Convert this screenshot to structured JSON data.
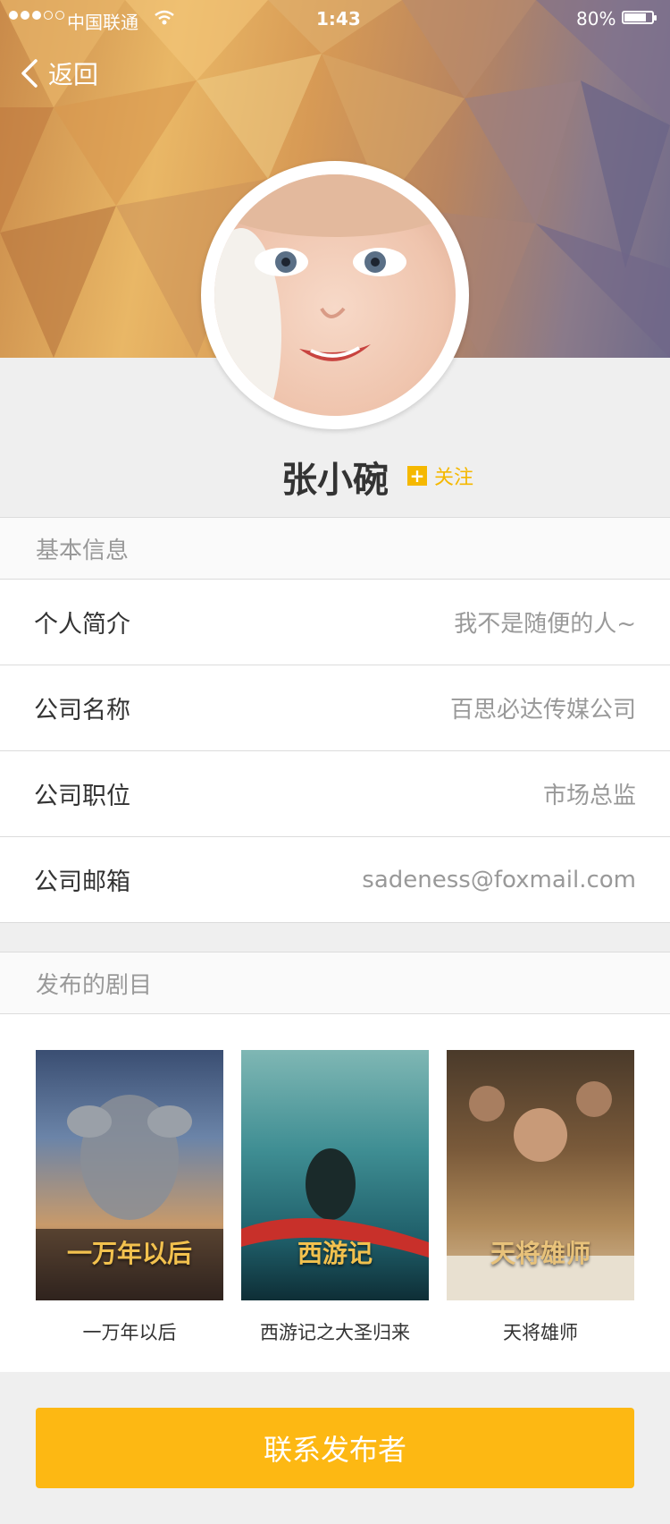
{
  "status_bar": {
    "carrier": "中国联通",
    "time": "1:43",
    "battery": "80%",
    "battery_level": 0.8
  },
  "nav": {
    "back_label": "返回"
  },
  "profile": {
    "name": "张小碗",
    "follow_label": "关注"
  },
  "basic_info": {
    "header": "基本信息",
    "rows": [
      {
        "label": "个人简介",
        "value": "我不是随便的人~"
      },
      {
        "label": "公司名称",
        "value": "百思必达传媒公司"
      },
      {
        "label": "公司职位",
        "value": "市场总监"
      },
      {
        "label": "公司邮箱",
        "value": "sadeness@foxmail.com"
      }
    ]
  },
  "shows": {
    "header": "发布的剧目",
    "items": [
      {
        "title": "一万年以后",
        "poster_art": "一万年以后"
      },
      {
        "title": "西游记之大圣归来",
        "poster_art": "西游记"
      },
      {
        "title": "天将雄师",
        "poster_art": "天将雄师"
      }
    ]
  },
  "contact_button": "联系发布者",
  "colors": {
    "accent": "#fdb813",
    "follow": "#f5b800"
  }
}
